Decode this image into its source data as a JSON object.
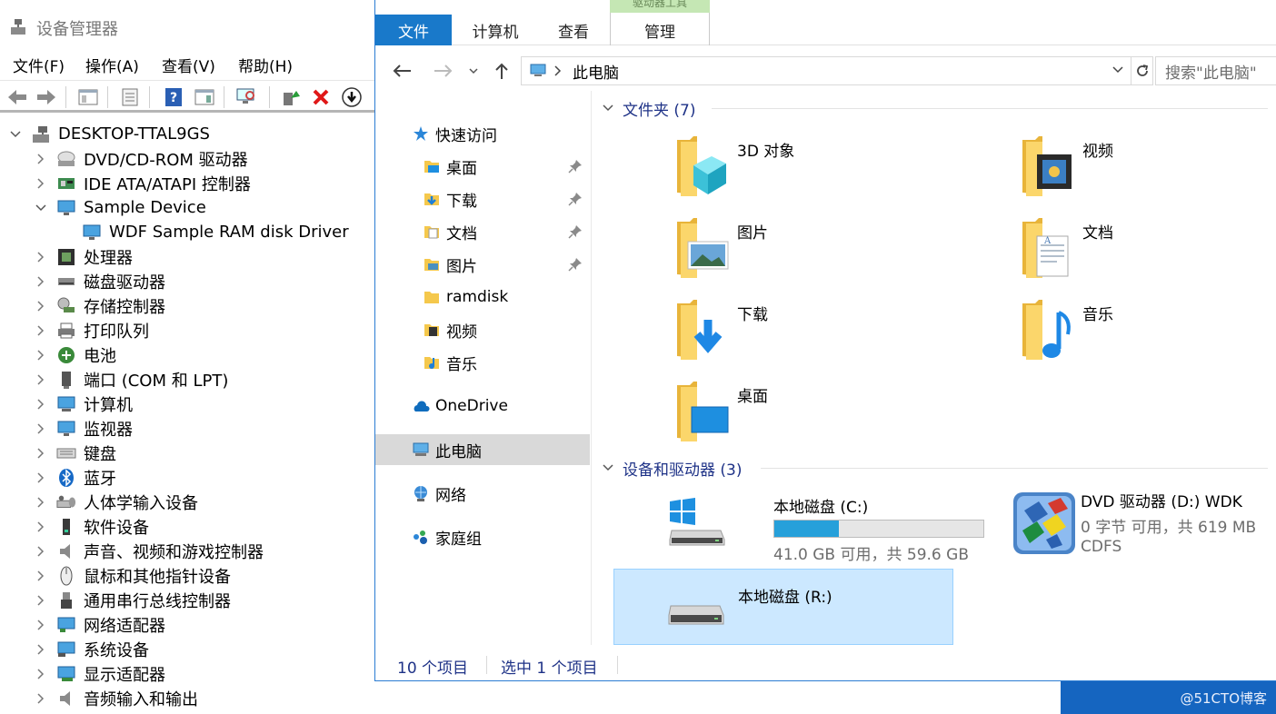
{
  "device_manager": {
    "title": "设备管理器",
    "menu": [
      "文件(F)",
      "操作(A)",
      "查看(V)",
      "帮助(H)"
    ],
    "root": "DESKTOP-TTAL9GS",
    "nodes": [
      {
        "label": "DVD/CD-ROM 驱动器",
        "icon": "dvd-drive-icon",
        "expanded": false
      },
      {
        "label": "IDE ATA/ATAPI 控制器",
        "icon": "ide-controller-icon",
        "expanded": false
      },
      {
        "label": "Sample Device",
        "icon": "monitor-icon",
        "expanded": true
      },
      {
        "label": "处理器",
        "icon": "processor-icon",
        "expanded": false
      },
      {
        "label": "磁盘驱动器",
        "icon": "disk-drive-icon",
        "expanded": false
      },
      {
        "label": "存储控制器",
        "icon": "storage-controller-icon",
        "expanded": false
      },
      {
        "label": "打印队列",
        "icon": "printer-icon",
        "expanded": false
      },
      {
        "label": "电池",
        "icon": "battery-icon",
        "expanded": false
      },
      {
        "label": "端口 (COM 和 LPT)",
        "icon": "port-icon",
        "expanded": false
      },
      {
        "label": "计算机",
        "icon": "computer-icon",
        "expanded": false
      },
      {
        "label": "监视器",
        "icon": "monitor-icon",
        "expanded": false
      },
      {
        "label": "键盘",
        "icon": "keyboard-icon",
        "expanded": false
      },
      {
        "label": "蓝牙",
        "icon": "bluetooth-icon",
        "expanded": false
      },
      {
        "label": "人体学输入设备",
        "icon": "hid-icon",
        "expanded": false
      },
      {
        "label": "软件设备",
        "icon": "software-device-icon",
        "expanded": false
      },
      {
        "label": "声音、视频和游戏控制器",
        "icon": "speaker-icon",
        "expanded": false
      },
      {
        "label": "鼠标和其他指针设备",
        "icon": "mouse-icon",
        "expanded": false
      },
      {
        "label": "通用串行总线控制器",
        "icon": "usb-icon",
        "expanded": false
      },
      {
        "label": "网络适配器",
        "icon": "network-adapter-icon",
        "expanded": false
      },
      {
        "label": "系统设备",
        "icon": "system-device-icon",
        "expanded": false
      },
      {
        "label": "显示适配器",
        "icon": "display-adapter-icon",
        "expanded": false
      },
      {
        "label": "音频输入和输出",
        "icon": "audio-io-icon",
        "expanded": false
      }
    ],
    "child": {
      "label": "WDF Sample RAM disk Driver",
      "icon": "monitor-icon"
    }
  },
  "explorer": {
    "ribbon_tabs": [
      "文件",
      "计算机",
      "查看",
      "管理"
    ],
    "context_group": "驱动器工具",
    "address": "此电脑",
    "search_placeholder": "搜索\"此电脑\"",
    "nav": {
      "quick_access": "快速访问",
      "quick_items": [
        {
          "label": "桌面",
          "pinned": true
        },
        {
          "label": "下载",
          "pinned": true
        },
        {
          "label": "文档",
          "pinned": true
        },
        {
          "label": "图片",
          "pinned": true
        },
        {
          "label": "ramdisk",
          "pinned": false
        },
        {
          "label": "视频",
          "pinned": false
        },
        {
          "label": "音乐",
          "pinned": false
        }
      ],
      "onedrive": "OneDrive",
      "this_pc": "此电脑",
      "network": "网络",
      "homegroup": "家庭组"
    },
    "folders_header": "文件夹 (7)",
    "folders": [
      {
        "name": "3D 对象",
        "icon": "3d-objects-folder-icon"
      },
      {
        "name": "视频",
        "icon": "videos-folder-icon"
      },
      {
        "name": "图片",
        "icon": "pictures-folder-icon"
      },
      {
        "name": "文档",
        "icon": "documents-folder-icon"
      },
      {
        "name": "下载",
        "icon": "downloads-folder-icon"
      },
      {
        "name": "音乐",
        "icon": "music-folder-icon"
      },
      {
        "name": "桌面",
        "icon": "desktop-folder-icon"
      }
    ],
    "drives_header": "设备和驱动器 (3)",
    "drives": [
      {
        "name": "本地磁盘 (C:)",
        "info": "41.0 GB 可用，共 59.6 GB",
        "used_fraction": 0.31,
        "icon": "windows-drive-icon"
      },
      {
        "name": "DVD 驱动器 (D:) WDK",
        "info": "0 字节 可用，共 619 MB",
        "fs": "CDFS",
        "icon": "dvd-wdk-icon"
      },
      {
        "name": "本地磁盘 (R:)",
        "icon": "hard-drive-icon",
        "selected": true
      }
    ],
    "status": {
      "count": "10 个项目",
      "selected": "选中 1 个项目"
    }
  },
  "watermark": "@51CTO博客",
  "colors": {
    "accent": "#1979ca",
    "selection": "#cce8ff",
    "header_text": "#1e3287",
    "bar_fill": "#26a0da"
  }
}
